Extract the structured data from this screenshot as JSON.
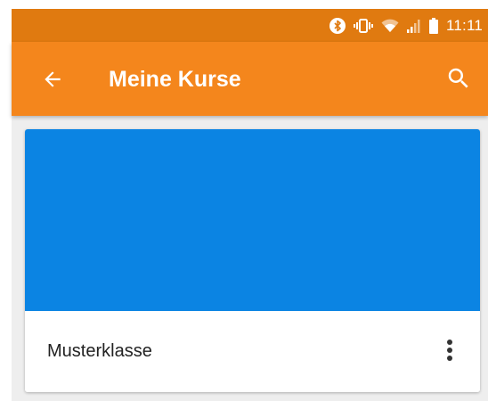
{
  "status_bar": {
    "time": "11:11",
    "icons": [
      "bluetooth-icon",
      "vibrate-icon",
      "wifi-icon",
      "signal-icon",
      "battery-icon"
    ]
  },
  "app_bar": {
    "title": "Meine Kurse",
    "back_icon": "arrow-back-icon",
    "search_icon": "search-icon"
  },
  "courses": [
    {
      "name": "Musterklasse",
      "banner_color": "#0b84e3",
      "menu_icon": "more-vert-icon"
    }
  ],
  "colors": {
    "status_bar": "#e07a10",
    "app_bar": "#f4861c",
    "background": "#eeeeee"
  }
}
